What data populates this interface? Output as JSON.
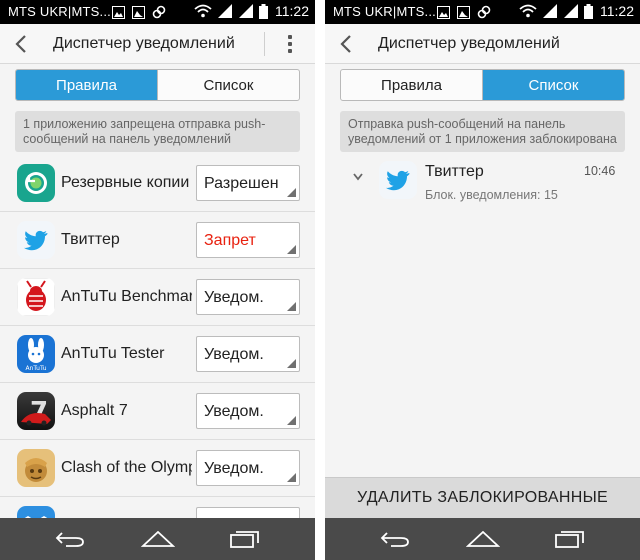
{
  "status_bar": {
    "carrier": "MTS UKR|MTS...",
    "time": "11:22"
  },
  "header": {
    "title": "Диспетчер уведомлений"
  },
  "tabs": {
    "rules": "Правила",
    "list": "Список"
  },
  "rules_screen": {
    "info": "1 приложению запрещена отправка push-сообщений на панель уведомлений",
    "apps": [
      {
        "name": "Резервные копии",
        "setting": "Разрешен",
        "icon": "backup-icon"
      },
      {
        "name": "Твиттер",
        "setting": "Запрет",
        "icon": "twitter-icon"
      },
      {
        "name": "AnTuTu Benchmark",
        "setting": "Уведом.",
        "icon": "antutu-benchmark-icon"
      },
      {
        "name": "AnTuTu Tester",
        "setting": "Уведом.",
        "icon": "antutu-tester-icon",
        "icon_label": "AnTuTu"
      },
      {
        "name": "Asphalt 7",
        "setting": "Уведом.",
        "icon": "asphalt-icon"
      },
      {
        "name": "Clash of the Olympus",
        "setting": "Уведом.",
        "icon": "clash-icon"
      }
    ],
    "colors": {
      "blocked_text": "#e8210f"
    }
  },
  "list_screen": {
    "info": "Отправка push-сообщений на панель уведомлений от 1 приложения заблокирована",
    "item": {
      "name": "Твиттер",
      "sub": "Блок. уведомления: 15",
      "time": "10:46",
      "icon": "twitter-icon"
    },
    "delete_button": "УДАЛИТЬ ЗАБЛОКИРОВАННЫЕ"
  },
  "colors": {
    "accent": "#2b9ad7",
    "twitter": "#1fa2e6",
    "navbar": "#4a4a4a"
  }
}
